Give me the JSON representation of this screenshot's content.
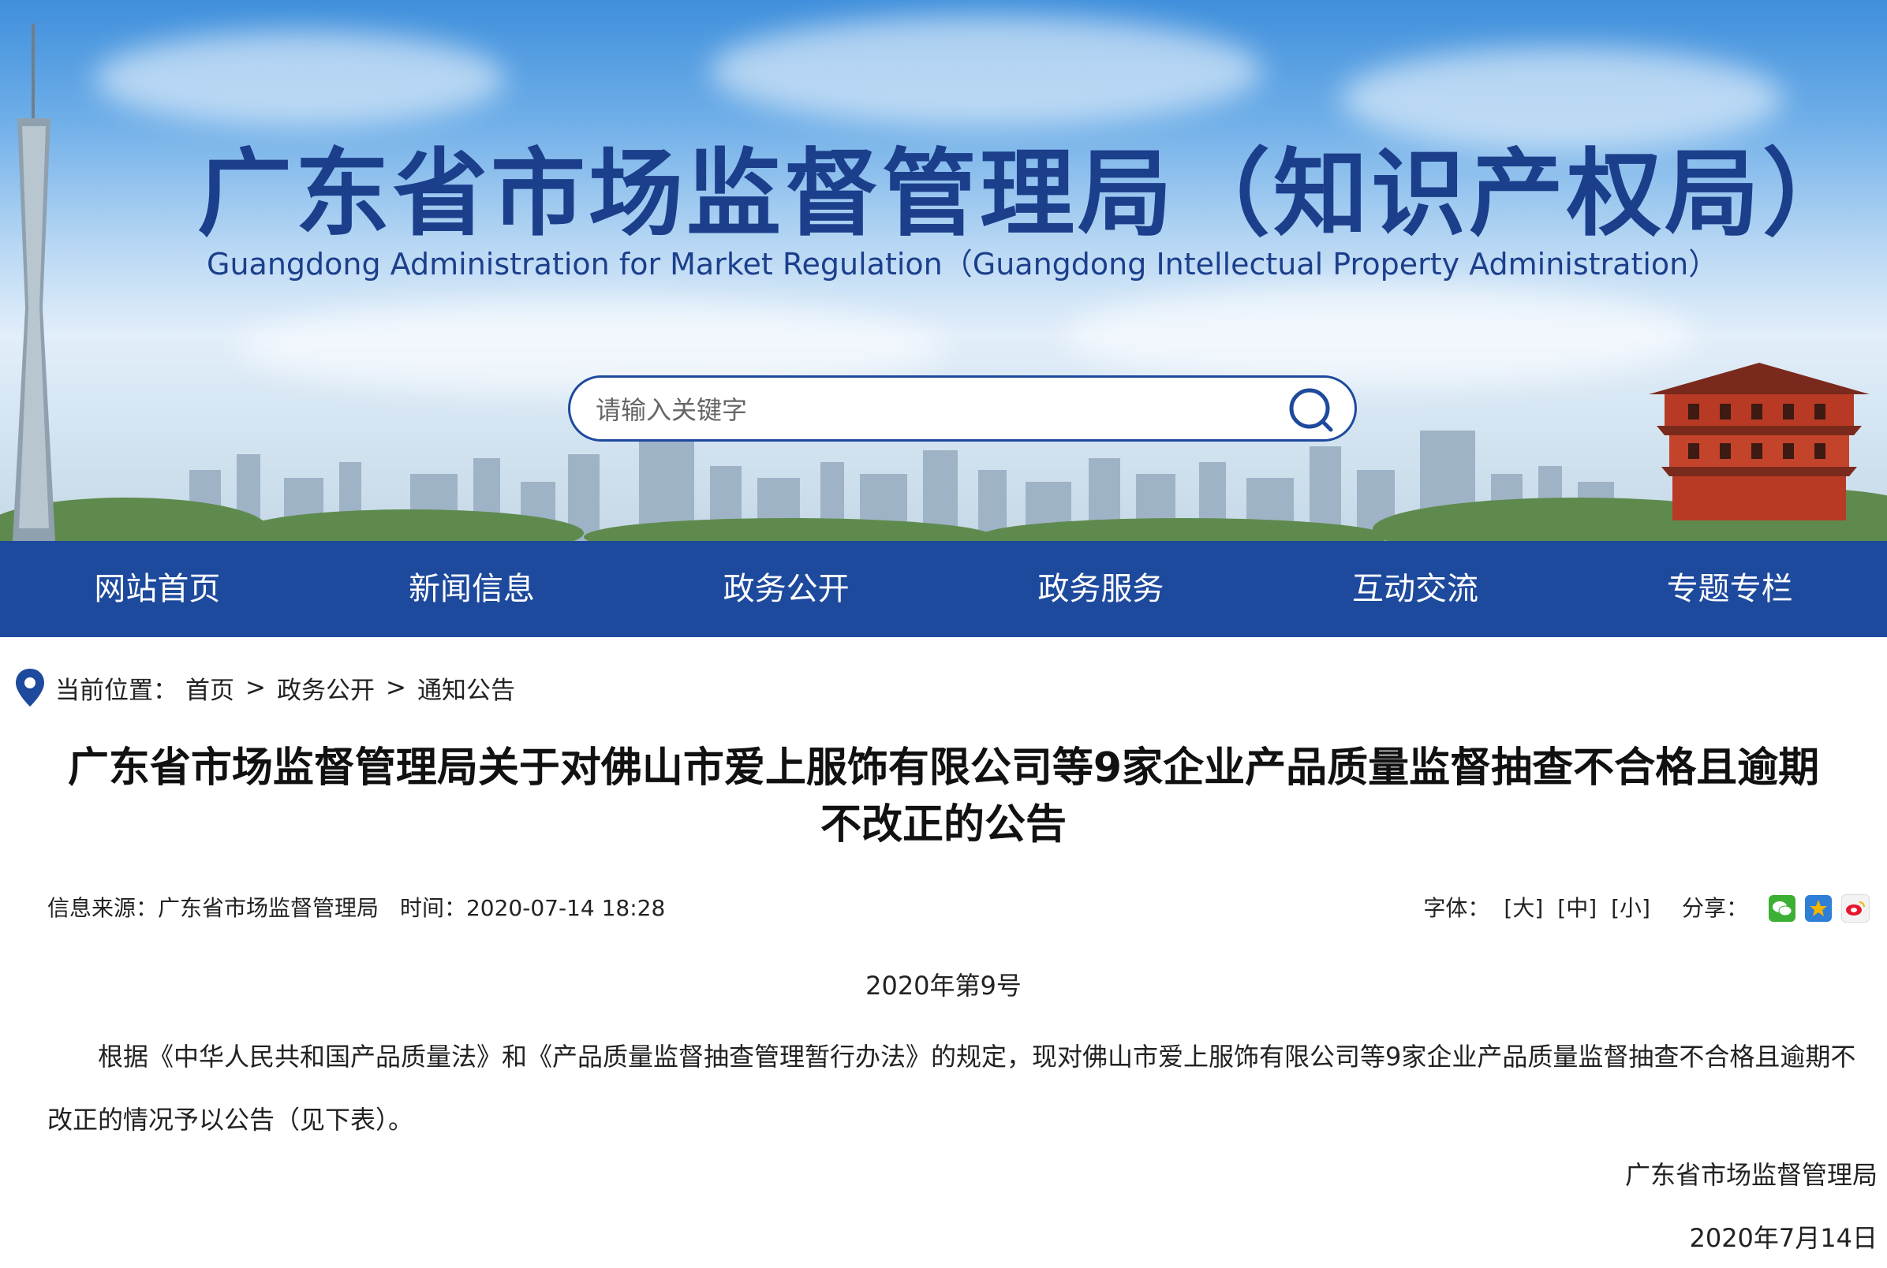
{
  "header": {
    "title_cn": "广东省市场监督管理局（知识产权局）",
    "title_en": "Guangdong Administration for Market Regulation（Guangdong Intellectual Property Administration）",
    "search_placeholder": "请输入关键字"
  },
  "nav": {
    "items": [
      "网站首页",
      "新闻信息",
      "政务公开",
      "政务服务",
      "互动交流",
      "专题专栏"
    ]
  },
  "breadcrumb": {
    "label": "当前位置：",
    "items": [
      "首页",
      "政务公开",
      "通知公告"
    ],
    "separator": ">"
  },
  "article": {
    "title": "广东省市场监督管理局关于对佛山市爱上服饰有限公司等9家企业产品质量监督抽查不合格且逾期不改正的公告",
    "source_label": "信息来源：",
    "source": "广东省市场监督管理局",
    "time_label": "时间：",
    "time": "2020-07-14 18:28",
    "font_label": "字体：",
    "font_sizes": [
      "[大]",
      "[中]",
      "[小]"
    ],
    "share_label": "分享：",
    "share_icons": [
      "wechat-icon",
      "qzone-icon",
      "weibo-icon"
    ],
    "doc_number": "2020年第9号",
    "body": "根据《中华人民共和国产品质量法》和《产品质量监督抽查管理暂行办法》的规定，现对佛山市爱上服饰有限公司等9家企业产品质量监督抽查不合格且逾期不改正的情况予以公告（见下表）。",
    "signature_org": "广东省市场监督管理局",
    "signature_date": "2020年7月14日"
  },
  "colors": {
    "brand_blue": "#1e4a9d",
    "title_blue": "#1c3f8c",
    "wechat_green": "#3cb034",
    "qzone_yellow": "#f4b400",
    "weibo_red": "#e6162d"
  }
}
